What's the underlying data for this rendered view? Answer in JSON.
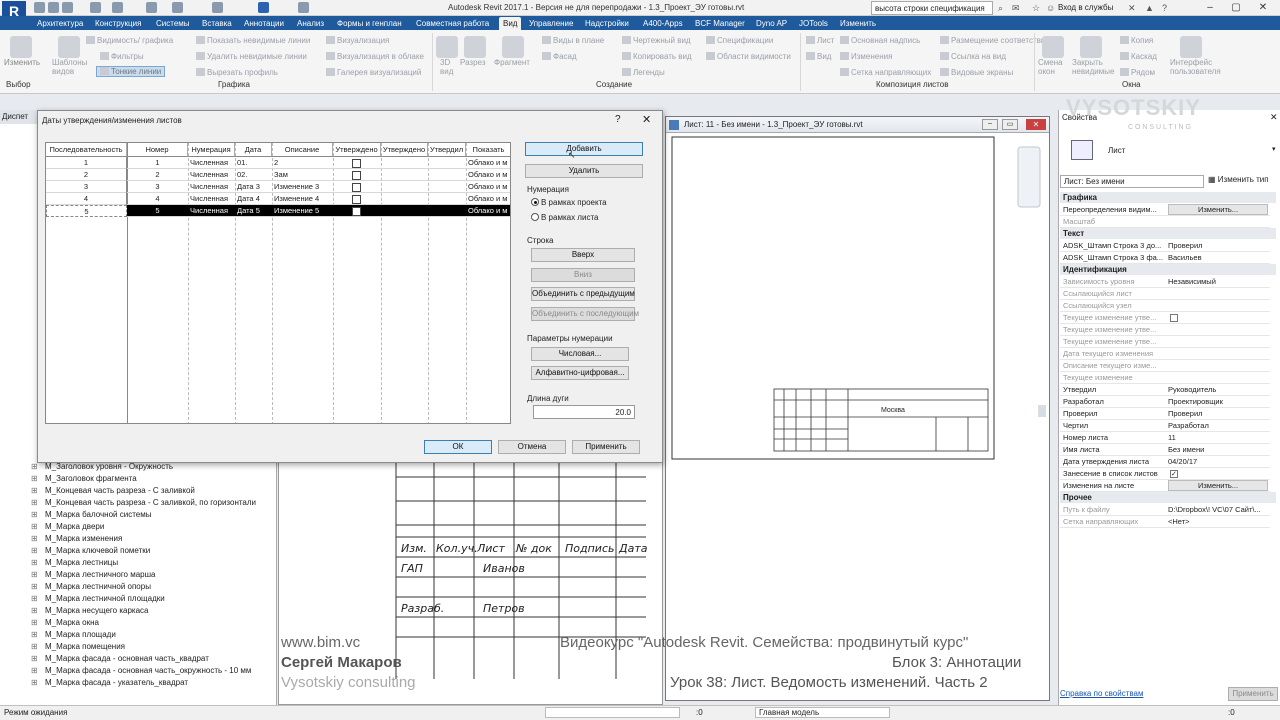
{
  "app": {
    "title": "Autodesk Revit 2017.1 - Версия не для перепродажи -    1.3_Проект_ЭУ готовы.rvt",
    "search_value": "высота строки спецификация",
    "login": "Вход в службы",
    "logo_letter": "R"
  },
  "tabs": [
    "Архитектура",
    "Конструкция",
    "Системы",
    "Вставка",
    "Аннотации",
    "Анализ",
    "Формы и генплан",
    "Совместная работа",
    "Вид",
    "Управление",
    "Надстройки",
    "A400-Apps",
    "BCF Manager",
    "Dyno AP",
    "JOTools",
    "Изменить"
  ],
  "active_tab": "Вид",
  "ribbon": {
    "select": "Выбор",
    "modify": "Изменить",
    "templates": "Шаблоны видов",
    "graphics_items": [
      "Видимость/ графика",
      "Фильтры",
      "Тонкие линии",
      "Показать невидимые линии",
      "Удалить невидимые линии",
      "Вырезать профиль",
      "Визуализация",
      "Визуализация в облаке",
      "Галерея визуализаций"
    ],
    "create_items": [
      "3D вид",
      "Разрез",
      "Фрагмент",
      "Виды в плане",
      "Фасад",
      "Чертежный вид",
      "Копировать вид",
      "Легенды",
      "Спецификации",
      "Области видимости"
    ],
    "sheet_items": [
      "Лист",
      "Вид",
      "Основная надпись",
      "Изменения",
      "Сетка направляющих",
      "Размещение соответствия",
      "Ссылка на вид",
      "Видовые экраны"
    ],
    "window_items": [
      "Смена окон",
      "Закрыть невидимые",
      "Копия",
      "Каскад",
      "Рядом",
      "Интерфейс пользователя"
    ],
    "panel_titles": [
      "Графика",
      "Создание",
      "Композиция листов",
      "Окна"
    ]
  },
  "project_browser": {
    "header": "Диспет",
    "items": [
      "М_Заголовок уровня - Окружность",
      "М_Заголовок фрагмента",
      "М_Концевая часть разреза - С заливкой",
      "М_Концевая часть разреза - С заливкой, по горизонтали",
      "М_Марка балочной системы",
      "М_Марка двери",
      "М_Марка изменения",
      "М_Марка ключевой пометки",
      "М_Марка лестницы",
      "М_Марка лестничного марша",
      "М_Марка лестничной опоры",
      "М_Марка лестничной площадки",
      "М_Марка несущего каркаса",
      "М_Марка окна",
      "М_Марка площади",
      "М_Марка помещения",
      "М_Марка фасада - основная часть_квадрат",
      "М_Марка фасада - основная часть_окружность - 10 мм",
      "М_Марка фасада - указатель_квадрат"
    ]
  },
  "dialog": {
    "title": "Даты утверждения/изменения листов",
    "help": "?",
    "close": "✕",
    "columns": [
      "Последовательность",
      "Номер",
      "Нумерация",
      "Дата",
      "Описание",
      "Утверждено",
      "Утверждено",
      "Утвердил",
      "Показать"
    ],
    "rows": [
      {
        "seq": "1",
        "num": "1",
        "numbering": "Численная",
        "date": "01.",
        "desc": "2",
        "show": "Облако и м"
      },
      {
        "seq": "2",
        "num": "2",
        "numbering": "Численная",
        "date": "02.",
        "desc": "Зам",
        "show": "Облако и м"
      },
      {
        "seq": "3",
        "num": "3",
        "numbering": "Численная",
        "date": "Дата 3",
        "desc": "Изменение 3",
        "show": "Облако и м"
      },
      {
        "seq": "4",
        "num": "4",
        "numbering": "Численная",
        "date": "Дата 4",
        "desc": "Изменение 4",
        "show": "Облако и м"
      },
      {
        "seq": "5",
        "num": "5",
        "numbering": "Численная",
        "date": "Дата 5",
        "desc": "Изменение 5",
        "show": "Облако и м"
      }
    ],
    "add": "Добавить",
    "delete": "Удалить",
    "numbering_label": "Нумерация",
    "radio_project": "В рамках проекта",
    "radio_sheet": "В рамках листа",
    "row_label": "Строка",
    "up": "Вверх",
    "down": "Вниз",
    "merge_prev": "Объединить с предыдущим",
    "merge_next": "Объединить с последующим",
    "num_params_label": "Параметры нумерации",
    "numeric_btn": "Числовая...",
    "alnum_btn": "Алфавитно-цифровая...",
    "arc_label": "Длина дуги",
    "arc_value": "20.0",
    "ok": "ОК",
    "cancel": "Отмена",
    "apply": "Применить"
  },
  "sheet_window": {
    "title": "Лист: 11 - Без имени - 1.3_Проект_ЭУ готовы.rvt",
    "city": "Москва"
  },
  "title_block": {
    "headers": [
      "Изм.",
      "Кол.уч.",
      "Лист",
      "№ док",
      "Подпись",
      "Дата"
    ],
    "rows": [
      {
        "role": "ГАП",
        "name": "Иванов"
      },
      {
        "role": "Разраб.",
        "name": "Петров"
      }
    ]
  },
  "properties": {
    "header": "Свойства",
    "family": "Лист",
    "selector": "Лист: Без имени",
    "edit_type": "Изменить тип",
    "groups": {
      "graphics": "Графика",
      "text": "Текст",
      "identity": "Идентификация",
      "other": "Прочее"
    },
    "graphics_rows": [
      [
        "Переопределения видим...",
        "Изменить..."
      ],
      [
        "Масштаб",
        ""
      ]
    ],
    "text_rows": [
      [
        "ADSK_Штамп Строка 3 до...",
        "Проверил"
      ],
      [
        "ADSK_Штамп Строка 3 фа...",
        "Васильев"
      ]
    ],
    "identity_rows": [
      [
        "Зависимость уровня",
        "Независимый"
      ],
      [
        "Ссылающийся лист",
        ""
      ],
      [
        "Ссылающийся узел",
        ""
      ],
      [
        "Текущее изменение утве...",
        ""
      ],
      [
        "Текущее изменение утве...",
        ""
      ],
      [
        "Текущее изменение утве...",
        ""
      ],
      [
        "Дата текущего изменения",
        ""
      ],
      [
        "Описание текущего изме...",
        ""
      ],
      [
        "Текущее изменение",
        ""
      ],
      [
        "Утвердил",
        "Руководитель"
      ],
      [
        "Разработал",
        "Проектировщик"
      ],
      [
        "Проверил",
        "Проверил"
      ],
      [
        "Чертил",
        "Разработал"
      ],
      [
        "Номер листа",
        "11"
      ],
      [
        "Имя листа",
        "Без имени"
      ],
      [
        "Дата утверждения листа",
        "04/20/17"
      ],
      [
        "Занесение в список листов",
        ""
      ],
      [
        "Изменения на листе",
        "Изменить..."
      ]
    ],
    "other_rows": [
      [
        "Путь к файлу",
        "D:\\Dropbox\\! VC\\07 Сайт\\..."
      ],
      [
        "Сетка направляющих",
        "<Нет>"
      ]
    ],
    "help_link": "Справка по свойствам",
    "apply": "Применить"
  },
  "overlay": {
    "site": "www.bim.vc",
    "author": "Сергей Макаров",
    "company": "Vysotskiy consulting",
    "course": "Видеокурс \"Autodesk Revit. Семейства: продвинутый курс\"",
    "block": "Блок 3: Аннотации",
    "lesson": "Урок 38: Лист. Ведомость изменений. Часть 2",
    "brand": "VYSOTSKIY",
    "brand_sub": "C O N S U L T I N G"
  },
  "status": {
    "text": "Режим ожидания",
    "scale": ":0",
    "model": "Главная модель",
    "zero": ":0"
  }
}
